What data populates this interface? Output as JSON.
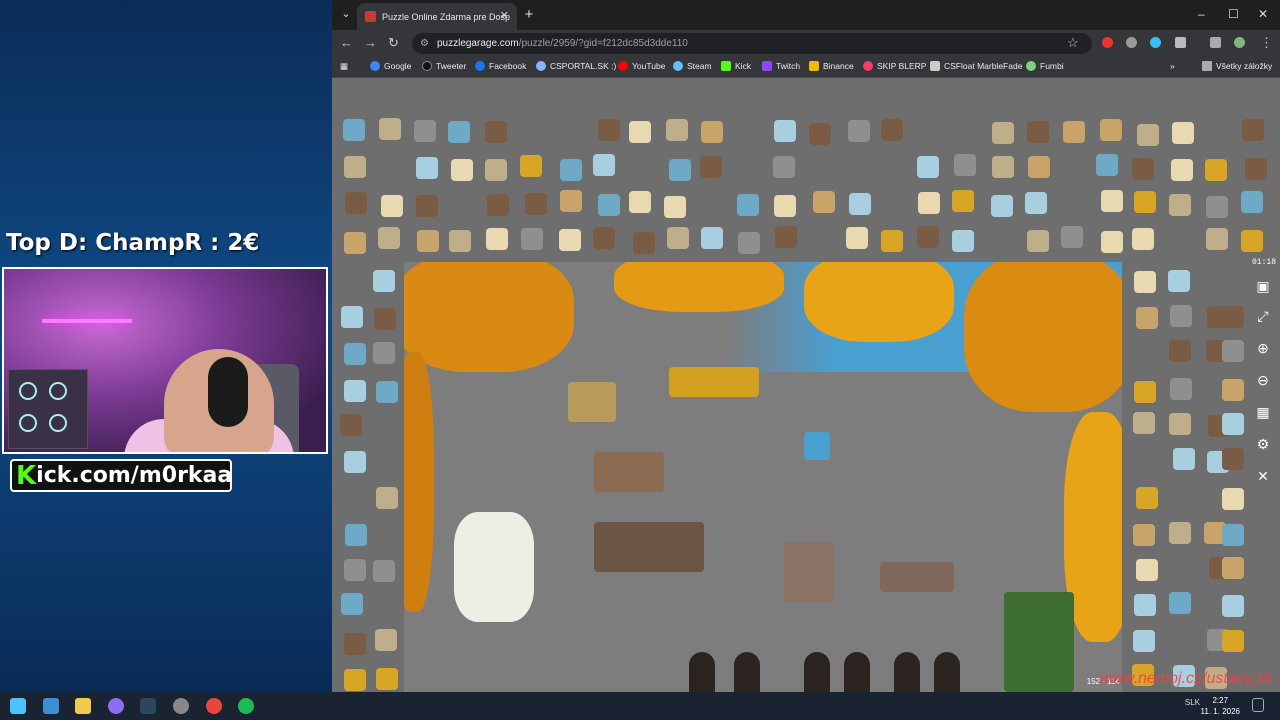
{
  "overlay": {
    "top_donation": "Top D: ChampR : 2€",
    "kick_prefix": "K",
    "kick_rest": "ick.com/m0rkaa"
  },
  "browser": {
    "tab_title": "Puzzle Online Zdarma pre Dosp",
    "url_host": "puzzlegarage.com",
    "url_path": "/puzzle/2959/?gid=f212dc85d3dde110",
    "bookmarks": [
      {
        "label": "Google",
        "color": "#4285f4"
      },
      {
        "label": "Tweeter",
        "color": "#000000"
      },
      {
        "label": "Facebook",
        "color": "#1877f2"
      },
      {
        "label": "CSPORTAL.SK :)",
        "color": "#8ab4f8"
      },
      {
        "label": "YouTube",
        "color": "#ff0000"
      },
      {
        "label": "Steam",
        "color": "#66c0f4"
      },
      {
        "label": "Kick",
        "color": "#53fc18"
      },
      {
        "label": "Twitch",
        "color": "#9146ff"
      },
      {
        "label": "Binance",
        "color": "#f0b90b"
      },
      {
        "label": "SKIP BLERP",
        "color": "#ff3b6b"
      },
      {
        "label": "CSFloat MarbleFade",
        "color": "#cccccc"
      },
      {
        "label": "Fumbi",
        "color": "#7bd37b"
      }
    ],
    "all_bookmarks": "Všetky záložky"
  },
  "puzzle": {
    "timer": "01:18",
    "count_a": "152",
    "count_b": "114",
    "watermark": "www.nemoj.cz/ustavy.sk"
  },
  "taskbar": {
    "lang": "SLK",
    "time": "2:27",
    "date": "11. 1. 2026"
  },
  "colors": {
    "accent_kick": "#53fc18",
    "sky": "#4a9fd1",
    "leaf": "#e8a317"
  }
}
